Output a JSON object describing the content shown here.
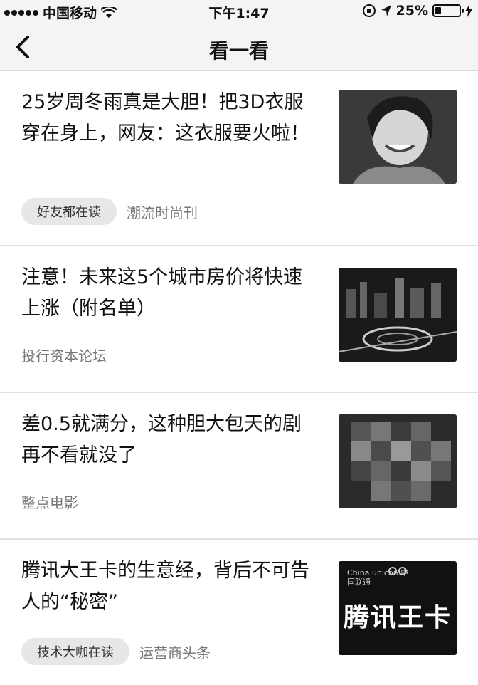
{
  "status_bar": {
    "carrier": "中国移动",
    "time": "下午1:47",
    "battery": "25%"
  },
  "nav": {
    "title": "看一看"
  },
  "articles": [
    {
      "headline": "25岁周冬雨真是大胆！把3D衣服穿在身上，网友：这衣服要火啦！",
      "tag": "好友都在读",
      "source": "潮流时尚刊",
      "thumb": "portrait-photo"
    },
    {
      "headline": "注意！未来这5个城市房价将快速上涨（附名单）",
      "tag": "",
      "source": "投行资本论坛",
      "thumb": "city-night-photo"
    },
    {
      "headline": "差0.5就满分，这种胆大包天的剧再不看就没了",
      "tag": "",
      "source": "整点电影",
      "thumb": "pixelated-photo"
    },
    {
      "headline": "腾讯大王卡的生意经，背后不可告人的“秘密”",
      "tag": "技术大咖在读",
      "source": "运营商头条",
      "thumb": "wangka-logo",
      "thumb_text": {
        "brand_en": "China unicom中国联通",
        "title": "腾讯王卡"
      }
    }
  ]
}
